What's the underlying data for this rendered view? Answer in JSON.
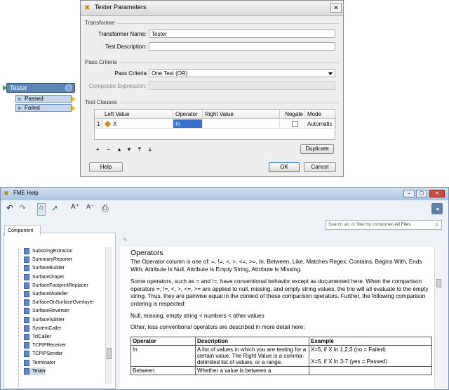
{
  "node": {
    "title": "Tester",
    "ports": [
      "Passed",
      "Failed"
    ]
  },
  "dialog": {
    "title": "Tester Parameters",
    "transformer_group": "Transformer",
    "name_label": "Transformer Name:",
    "name_value": "Tester",
    "desc_label": "Test Description:",
    "desc_value": "",
    "pass_group": "Pass Criteria",
    "pass_label": "Pass Criteria",
    "pass_value": "One Test (OR)",
    "composite_label": "Composite Expression:",
    "composite_value": "",
    "clauses_group": "Test Clauses",
    "columns": [
      "Left Value",
      "Operator",
      "Right Value",
      "Negate",
      "Mode"
    ],
    "row": {
      "index": "1",
      "left": "X",
      "operator": "In",
      "right": "",
      "negate": false,
      "mode": "Automatic"
    },
    "tools": [
      "+",
      "−",
      "▴",
      "▾",
      "⤒",
      "⤓"
    ],
    "duplicate_label": "Duplicate",
    "help_label": "Help",
    "ok_label": "OK",
    "cancel_label": "Cancel"
  },
  "help": {
    "title": "FME Help",
    "search_placeholder": "Search all, or filter by componen",
    "search_scope": "All Files",
    "tab_label": "Component",
    "tree": [
      "SubstringExtractor",
      "SummaryReporter",
      "SurfaceBuilder",
      "SurfaceDraper",
      "SurfaceFootprintReplacer",
      "SurfaceModeller",
      "SurfaceOnSurfaceOverlayer",
      "SurfaceReverser",
      "SurfaceSplitter",
      "SystemCaller",
      "TclCaller",
      "TCPIPReceiver",
      "TCPIPSender",
      "Terminator",
      "Tester"
    ],
    "selected": "Tester",
    "heading": "Operators",
    "para1": "The Operator column is one of: =, !=, <, >, <=, >=, In, Between, Like, Matches Regex, Contains, Begins With, Ends With, Attribute Is Null, Attribute Is Empty String, Attribute Is Missing.",
    "para2": "Some operators, such as = and !=, have conventional behavior except as documented here. When the comparison operators =, !=, <, >, <=, >= are applied to null, missing, and empty string values, the trio will all evaluate to the empty string. Thus, they are pairwise equal in the context of these comparison operators. Further, the following comparison ordering is respected:",
    "para3": "Null, missing, empty string < numbers < other values",
    "para4": "Other, less conventional operators are described in more detail here:",
    "table_headers": [
      "Operator",
      "Description",
      "Example"
    ],
    "table_row": {
      "op": "In",
      "desc": "A list of values in which you are testing for a certain value. The Right Value is a comma-delimited list of values, or a range.",
      "ex1": "X=5, if X In 1,2,3 (no = Failed)",
      "ex2": "X=5, if X In 3-7 (yes = Passed)"
    },
    "table_row2": {
      "op": "Between",
      "desc": "Whether a value is between a"
    }
  }
}
